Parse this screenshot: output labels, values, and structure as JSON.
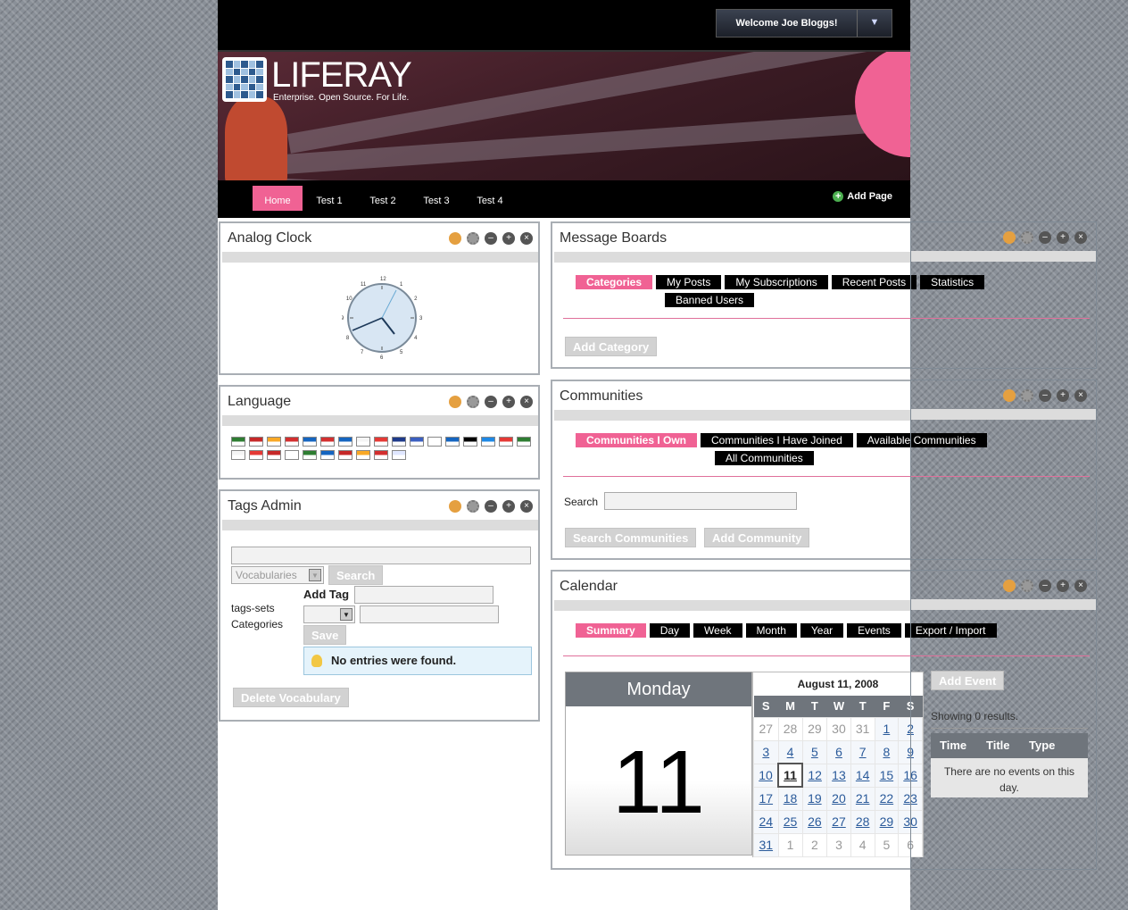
{
  "header": {
    "welcome": "Welcome Joe Bloggs!",
    "menu_icon": "chevron-down-icon"
  },
  "logo": {
    "name": "LIFERAY",
    "tagline": "Enterprise. Open Source. For Life."
  },
  "nav": {
    "tabs": [
      {
        "label": "Home",
        "active": true
      },
      {
        "label": "Test 1"
      },
      {
        "label": "Test 2"
      },
      {
        "label": "Test 3"
      },
      {
        "label": "Test 4"
      }
    ],
    "add_page": "Add Page"
  },
  "clock": {
    "title": "Analog Clock",
    "numbers": [
      "12",
      "1",
      "2",
      "3",
      "4",
      "5",
      "6",
      "7",
      "8",
      "9",
      "10",
      "11"
    ]
  },
  "language": {
    "title": "Language",
    "flag_colors": [
      "#2e7d32",
      "#c62828",
      "#f9a825",
      "#d32f2f",
      "#1565c0",
      "#d32f2f",
      "#1565c0",
      "#f5f5f5",
      "#e53935",
      "#1e3a8a",
      "#3b5fc0",
      "#ffffff",
      "#1565c0",
      "#000000",
      "#1e88e5",
      "#e53935",
      "#2e7d32",
      "#f5f5f5",
      "#e53935",
      "#c62828",
      "#ffffff",
      "#2e7d32",
      "#1565c0",
      "#c62828",
      "#f9a825",
      "#d32f2f",
      "#e0e7ff"
    ]
  },
  "tags": {
    "title": "Tags Admin",
    "vocab_select": "Vocabularies",
    "search": "Search",
    "add_tag": "Add Tag",
    "tags_sets": "tags-sets",
    "categories": "Categories",
    "save": "Save",
    "no_entries": "No entries were found.",
    "delete_vocab": "Delete Vocabulary"
  },
  "boards": {
    "title": "Message Boards",
    "tabs": [
      "Categories",
      "My Posts",
      "My Subscriptions",
      "Recent Posts",
      "Statistics",
      "Banned Users"
    ],
    "add_category": "Add Category"
  },
  "communities": {
    "title": "Communities",
    "tabs": [
      "Communities I Own",
      "Communities I Have Joined",
      "Available Communities",
      "All Communities"
    ],
    "search_label": "Search",
    "search_btn": "Search Communities",
    "add_btn": "Add Community"
  },
  "calendar": {
    "title": "Calendar",
    "tabs": [
      "Summary",
      "Day",
      "Week",
      "Month",
      "Year",
      "Events",
      "Export / Import"
    ],
    "weekday": "Monday",
    "day_number": "11",
    "month_title": "August 11, 2008",
    "dow": [
      "S",
      "M",
      "T",
      "W",
      "T",
      "F",
      "S"
    ],
    "weeks": [
      [
        "27",
        "28",
        "29",
        "30",
        "31",
        "1",
        "2"
      ],
      [
        "3",
        "4",
        "5",
        "6",
        "7",
        "8",
        "9"
      ],
      [
        "10",
        "11",
        "12",
        "13",
        "14",
        "15",
        "16"
      ],
      [
        "17",
        "18",
        "19",
        "20",
        "21",
        "22",
        "23"
      ],
      [
        "24",
        "25",
        "26",
        "27",
        "28",
        "29",
        "30"
      ],
      [
        "31",
        "1",
        "2",
        "3",
        "4",
        "5",
        "6"
      ]
    ],
    "add_event": "Add Event",
    "showing": "Showing 0 results.",
    "cols": [
      "Time",
      "Title",
      "Type"
    ],
    "no_events": "There are no events on this day."
  }
}
